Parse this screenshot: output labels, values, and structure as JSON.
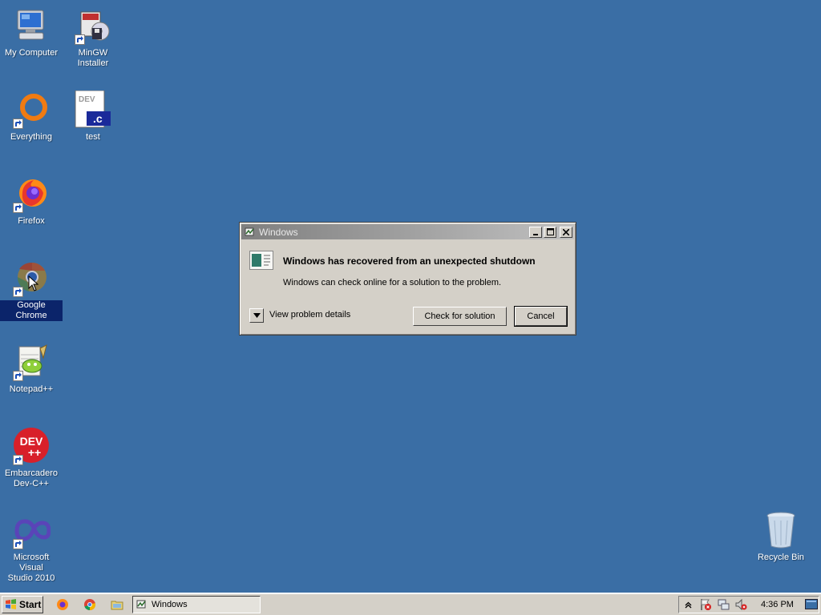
{
  "desktop": {
    "background": "#3a6ea5",
    "icons": [
      {
        "label": "My Computer"
      },
      {
        "label": "MinGW\nInstaller"
      },
      {
        "label": "Everything"
      },
      {
        "label": "test"
      },
      {
        "label": "Firefox"
      },
      {
        "label": "Google Chrome"
      },
      {
        "label": "Notepad++"
      },
      {
        "label": "Embarcadero\nDev-C++"
      },
      {
        "label": "Microsoft Visual\nStudio 2010"
      },
      {
        "label": "Recycle Bin"
      }
    ],
    "test_icon_text": "DEV",
    "test_icon_ext": ".c",
    "devcpp_icon_text": "DEV",
    "devcpp_icon_sub": "++"
  },
  "dialog": {
    "title": "Windows",
    "heading": "Windows has recovered from an unexpected shutdown",
    "message": "Windows can check online for a solution to the problem.",
    "details_label": "View problem details",
    "check_button": "Check for solution",
    "cancel_button": "Cancel"
  },
  "taskbar": {
    "start_label": "Start",
    "task_label": "Windows",
    "clock": "4:36 PM"
  }
}
